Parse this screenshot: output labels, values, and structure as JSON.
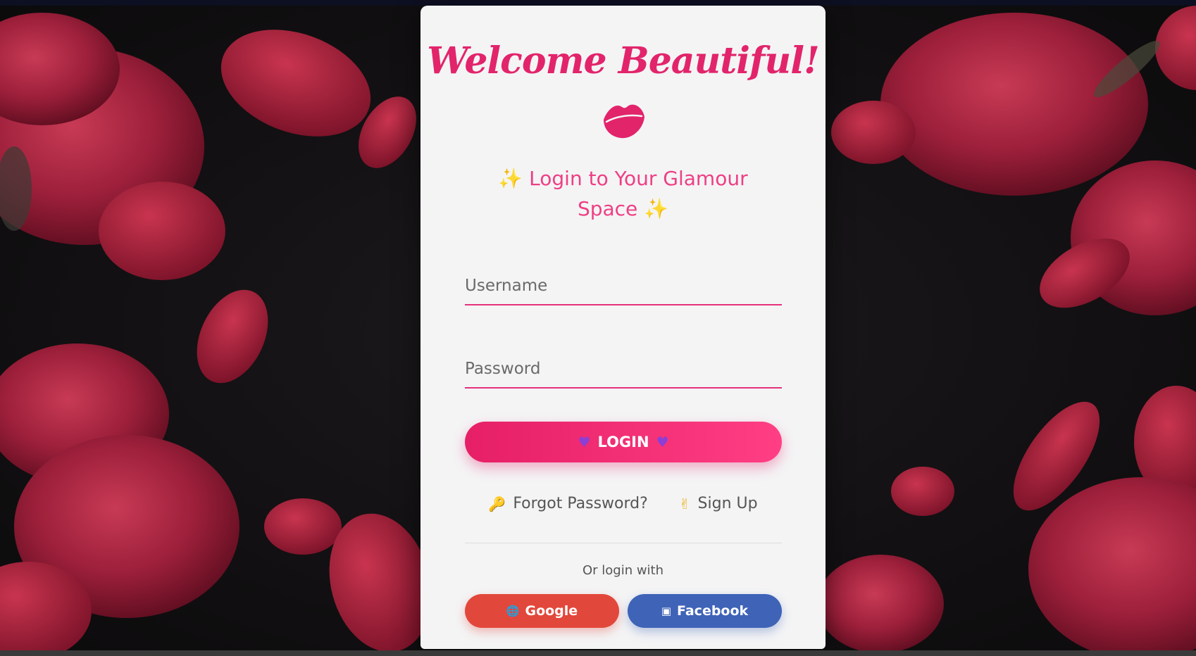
{
  "login_card": {
    "title": "Welcome Beautiful!",
    "emblem": "lips-icon",
    "subtitle": "✨ Login to Your Glamour Space ✨",
    "username_placeholder": "Username",
    "password_placeholder": "Password",
    "login_button": {
      "label": "LOGIN",
      "icon": "purple-heart-icon"
    },
    "links": [
      {
        "icon": "🔑",
        "label": "Forgot Password?"
      },
      {
        "icon": "✌",
        "label": "Sign Up"
      }
    ],
    "social_prompt": "Or login with",
    "social_buttons": {
      "google": {
        "icon": "🌐",
        "label": "Google"
      },
      "facebook": {
        "icon": "▣",
        "label": "Facebook"
      }
    }
  },
  "colors": {
    "brand_pink": "#e2246b",
    "login_gradient_start": "#e61f66",
    "login_gradient_end": "#ff3e84",
    "google_red": "#e2473b",
    "facebook_blue": "#3f63b7",
    "card_background": "#f4f4f5"
  },
  "background": {
    "theme": "red rose petals on dark background"
  }
}
